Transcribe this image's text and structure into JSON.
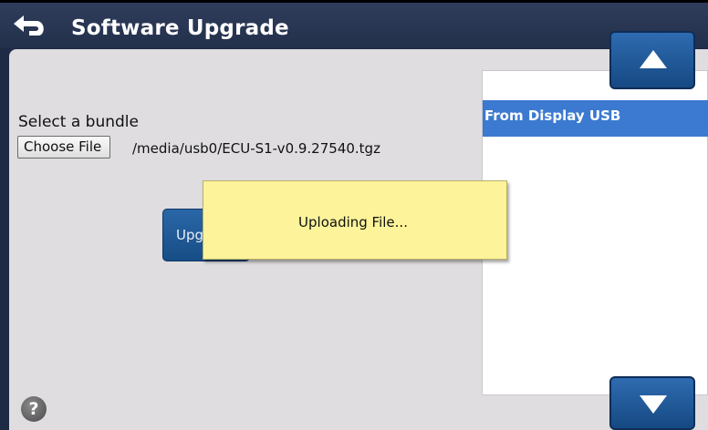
{
  "header": {
    "title": "Software Upgrade",
    "back_icon": "back-arrow-icon"
  },
  "bundle": {
    "label": "Select a bundle",
    "choose_button": "Choose File",
    "file_path": "/media/usb0/ECU-S1-v0.9.27540.tgz"
  },
  "upgrade_button": {
    "label": "Upg"
  },
  "source_list": {
    "items": [
      {
        "label": "From Display USB",
        "selected": true
      }
    ],
    "scroll_up_icon": "arrow-up-icon",
    "scroll_down_icon": "arrow-down-icon"
  },
  "dialog": {
    "message": "Uploading File..."
  },
  "help": {
    "glyph": "?",
    "icon": "help-icon"
  },
  "colors": {
    "header_bg": "#2f3d5c",
    "panel_bg": "#dfdde0",
    "accent": "#3b7ad0",
    "dialog_bg": "#fdf39a"
  }
}
